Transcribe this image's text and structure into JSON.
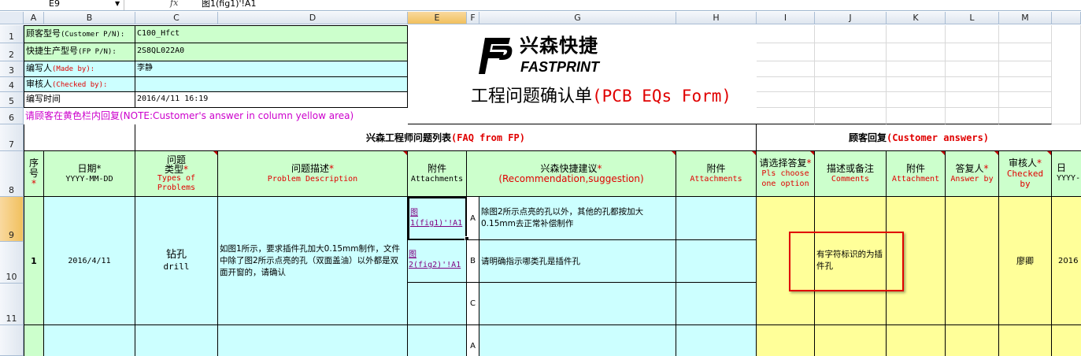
{
  "formula_bar": {
    "name_box": "E9",
    "fx": "fx",
    "formula": "图1(fig1)'!A1"
  },
  "columns": [
    "A",
    "B",
    "C",
    "D",
    "E",
    "F",
    "G",
    "H",
    "I",
    "J",
    "K",
    "L",
    "M"
  ],
  "rows": [
    "1",
    "2",
    "3",
    "4",
    "5",
    "6",
    "7",
    "8",
    "9",
    "10",
    "11"
  ],
  "info": {
    "customer_pn_label": "顾客型号",
    "customer_pn_en": "(Customer P/N):",
    "customer_pn_value": "C100_Hfct",
    "fp_pn_label": "快捷生产型号",
    "fp_pn_en": "(FP P/N):",
    "fp_pn_value": "2S8QL022A0",
    "made_by_label": "编写人",
    "made_by_en": "(Made by):",
    "made_by_value": "李静",
    "checked_by_label": "审核人",
    "checked_by_en": "(Checked by):",
    "checked_by_value": "",
    "time_label": "编写时间",
    "time_value": "2016/4/11 16:19",
    "note": "请顾客在黄色栏内回复(NOTE:Customer's answer in column yellow area)"
  },
  "logo": {
    "cn": "兴森快捷",
    "en": "FASTPRINT"
  },
  "form_title": {
    "cn": "工程问题确认单",
    "en": "(PCB EQs Form)"
  },
  "faq_header": {
    "cn": "兴森工程师问题列表",
    "en": "(FAQ from FP)"
  },
  "customer_header": {
    "cn": "顾客回复",
    "en": "(Customer answers)"
  },
  "col_headers": {
    "seq_cn1": "序",
    "seq_cn2": "号",
    "star": "*",
    "date_cn": "日期*",
    "date_en": "YYYY-MM-DD",
    "type_cn1": "问题",
    "type_cn2": "类型",
    "type_en1": "Types of",
    "type_en2": "Problems",
    "desc_cn": "问题描述",
    "desc_en": "Problem Description",
    "att_cn": "附件",
    "att_en": "Attachments",
    "sugg_cn": "兴森快捷建议",
    "sugg_en": "(Recommendation,suggestion)",
    "att2_cn": "附件",
    "att2_en": "Attachments",
    "choose_cn": "请选择答复",
    "choose_en1": "Pls choose",
    "choose_en2": "one option",
    "comments_cn": "描述或备注",
    "comments_en": "Comments",
    "att3_cn": "附件",
    "att3_en": "Attachment",
    "answer_cn": "答复人",
    "answer_en": "Answer by",
    "checked_cn": "审核人",
    "checked_en1": "Checked",
    "checked_en2": "by",
    "date2_cn": "日",
    "date2_en": "YYYY-"
  },
  "row1": {
    "seq": "1",
    "date": "2016/4/11",
    "type_cn": "钻孔",
    "type_en": "drill",
    "description": "如图1所示，要求插件孔加大0.15mm制作，文件中除了图2所示点亮的孔（双面盖油）以外都是双面开窗的，请确认",
    "link1_a": "图",
    "link1_b": "1(fig1)'!A1",
    "link2_a": "图",
    "link2_b": "2(fig2)'!A1",
    "opt_a": "A",
    "opt_b": "B",
    "opt_c": "C",
    "sugg_a": "除图2所示点亮的孔以外，其他的孔都按加大0.15mm去正常补偿制作",
    "sugg_b": "请明确指示哪类孔是插件孔",
    "sugg_c": "",
    "comment": "有字符标识的为插件孔",
    "checked_by": "廖卿",
    "date2": "2016"
  },
  "row2": {
    "opt_a": "A"
  },
  "colors": {
    "green": "#ccffcc",
    "cyan": "#ccffff",
    "yellow": "#ffff99",
    "red": "#e00000",
    "magenta": "#cc00cc",
    "highlight_box": "#e00000"
  }
}
